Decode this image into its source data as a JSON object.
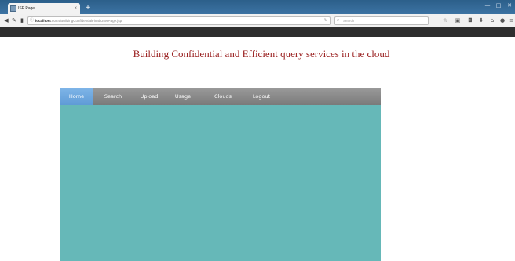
{
  "browser": {
    "tab_title": "ISP Page",
    "tab_close": "×",
    "new_tab": "+",
    "url_host": "localhost",
    "url_path": ":8084/BuildingConfidentialFinal/UserPage.jsp",
    "url_info": "ⓘ",
    "url_refresh": "↻",
    "search_placeholder": "Search",
    "window_controls": [
      "—",
      "□",
      "✕"
    ]
  },
  "page": {
    "title": "Building Confidential and Efficient query services in the cloud"
  },
  "menu": {
    "items": [
      {
        "label": "Home",
        "active": true
      },
      {
        "label": "Search",
        "active": false
      },
      {
        "label": "Upload",
        "active": false
      },
      {
        "label": "Usage",
        "active": false
      },
      {
        "label": "Clouds",
        "active": false
      },
      {
        "label": "Logout",
        "active": false
      }
    ]
  },
  "colors": {
    "title": "#9a2020",
    "panel": "#66b8b8",
    "menu_active": "#6fa8df",
    "menu_bg": "#8a8a8a"
  }
}
